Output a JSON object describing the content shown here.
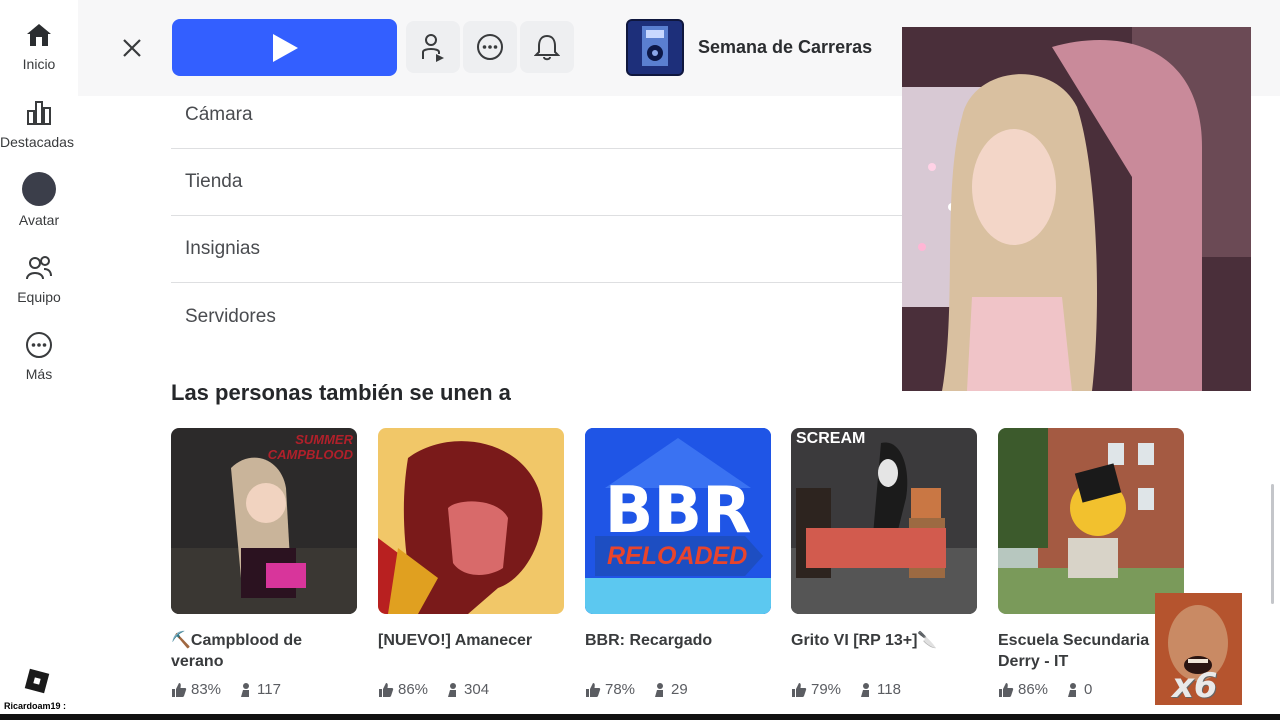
{
  "rail": {
    "items": [
      {
        "label": "Inicio"
      },
      {
        "label": "Destacadas"
      },
      {
        "label": "Avatar"
      },
      {
        "label": "Equipo"
      },
      {
        "label": "Más"
      }
    ],
    "username": "Ricardoam19 :"
  },
  "topbar": {
    "game_title": "Semana de Carreras"
  },
  "menu": {
    "items": [
      {
        "label": "Cámara"
      },
      {
        "label": "Tienda"
      },
      {
        "label": "Insignias"
      },
      {
        "label": "Servidores"
      }
    ]
  },
  "section": {
    "title": "Las personas también se unen a",
    "games": [
      {
        "name": "⛏️Campblood de verano",
        "rating": "83%",
        "players": "117",
        "thumb_text": "SUMMER CAMPBLOOD"
      },
      {
        "name": "[NUEVO!] Amanecer",
        "rating": "86%",
        "players": "304"
      },
      {
        "name": "BBR: Recargado",
        "rating": "78%",
        "players": "29",
        "thumb_text": "BBR",
        "thumb_sub": "RELOADED"
      },
      {
        "name": "Grito VI [RP 13+]🔪",
        "rating": "79%",
        "players": "118",
        "thumb_text": "SCREAM"
      },
      {
        "name": "Escuela Secundaria Derry - IT",
        "rating": "86%",
        "players": "0"
      }
    ]
  },
  "overlay": {
    "meme_label": "x6"
  },
  "colors": {
    "accent": "#335fff",
    "text": "#393b3d"
  }
}
